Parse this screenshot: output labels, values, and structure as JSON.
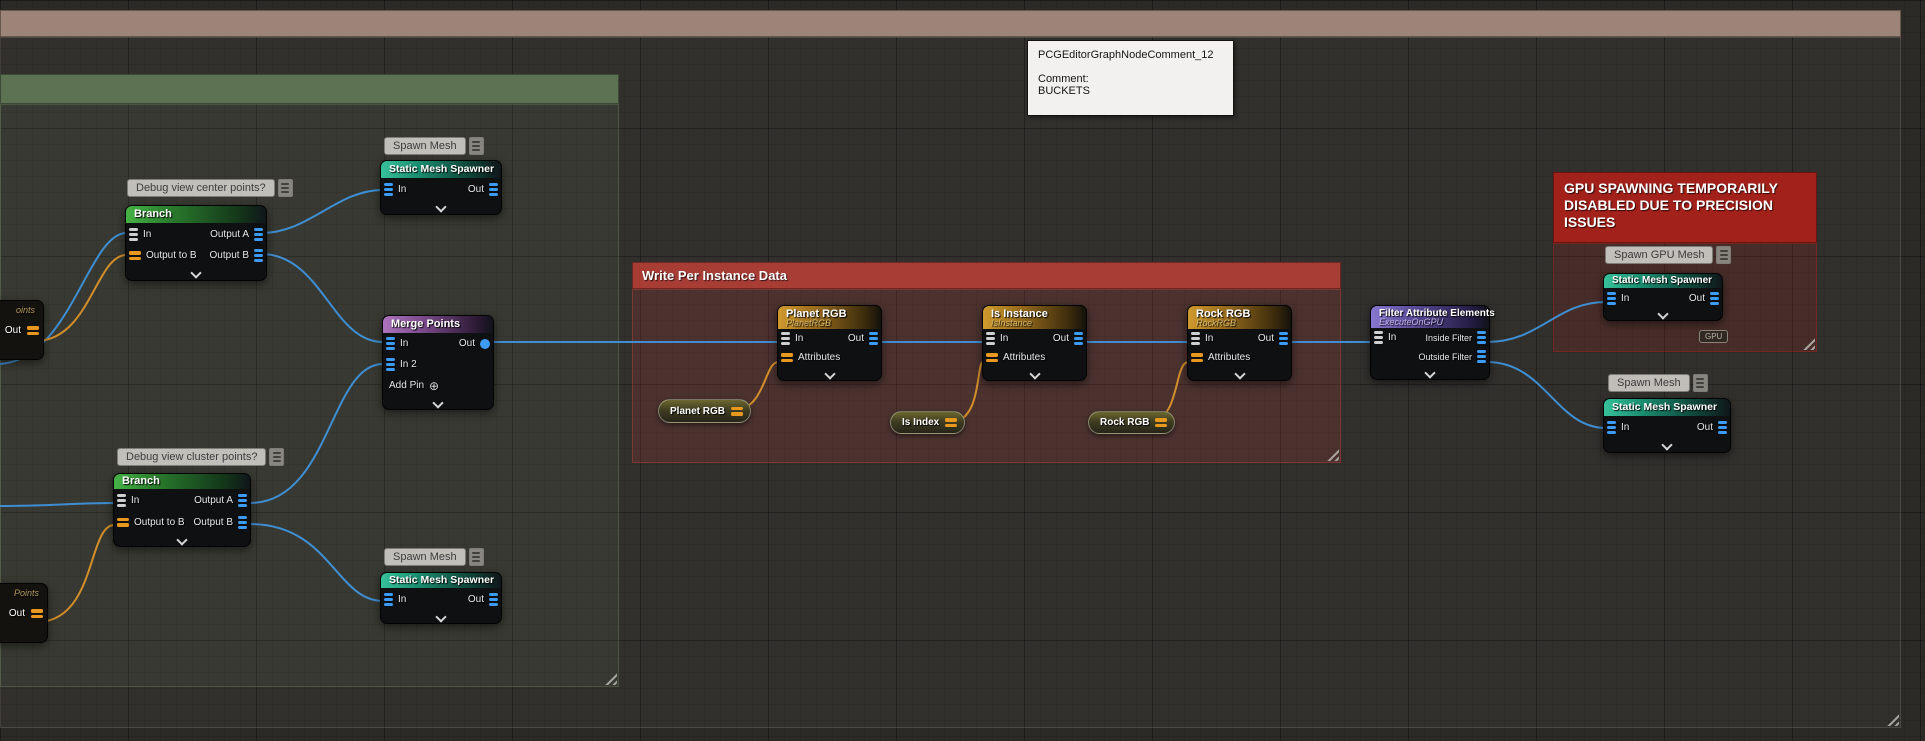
{
  "colors": {
    "wire-blue": "#3f8ed2",
    "wire-orange": "#d28e2a",
    "pin-blue": "#3c9bf5",
    "pin-orange": "#e8981e",
    "comment-tan": "#9d8478",
    "comment-green": "#5c7252",
    "comment-red": "#a83d36",
    "comment-red-bright": "#a2211a"
  },
  "tooltip": {
    "title": "PCGEditorGraphNodeComment_12",
    "comment_label": "Comment:",
    "comment_value": "BUCKETS"
  },
  "comments": {
    "write_per_instance": {
      "title": "Write Per Instance Data"
    },
    "gpu_warning": {
      "title": "GPU SPAWNING TEMPORARILY DISABLED DUE TO PRECISION ISSUES"
    }
  },
  "bubbles": {
    "debug_center": {
      "label": "Debug view center points?"
    },
    "debug_cluster": {
      "label": "Debug view cluster points?"
    },
    "spawn_mesh_top": {
      "label": "Spawn Mesh"
    },
    "spawn_mesh_bottom": {
      "label": "Spawn Mesh"
    },
    "spawn_mesh_right": {
      "label": "Spawn Mesh"
    },
    "spawn_gpu_mesh": {
      "label": "Spawn GPU Mesh"
    }
  },
  "nodes": {
    "branch_center": {
      "title": "Branch",
      "in": "In",
      "out_a": "Output A",
      "out_to_b": "Output to B",
      "out_b": "Output B"
    },
    "branch_cluster": {
      "title": "Branch",
      "in": "In",
      "out_a": "Output A",
      "out_to_b": "Output to B",
      "out_b": "Output B"
    },
    "sms_top": {
      "title": "Static Mesh Spawner",
      "in": "In",
      "out": "Out"
    },
    "sms_bottom": {
      "title": "Static Mesh Spawner",
      "in": "In",
      "out": "Out"
    },
    "sms_gpu": {
      "title": "Static Mesh Spawner",
      "in": "In",
      "out": "Out"
    },
    "sms_right": {
      "title": "Static Mesh Spawner",
      "in": "In",
      "out": "Out"
    },
    "merge_points": {
      "title": "Merge Points",
      "in": "In",
      "out": "Out",
      "in2": "In 2",
      "add_pin": "Add Pin"
    },
    "planet_rgb": {
      "title": "Planet RGB",
      "subtitle": "PlanetRGB",
      "in": "In",
      "out": "Out",
      "attributes": "Attributes"
    },
    "is_instance": {
      "title": "Is Instance",
      "subtitle": "IsInstance",
      "in": "In",
      "out": "Out",
      "attributes": "Attributes"
    },
    "rock_rgb": {
      "title": "Rock RGB",
      "subtitle": "RockRGB",
      "in": "In",
      "out": "Out",
      "attributes": "Attributes"
    },
    "filter_attr": {
      "title": "Filter Attribute Elements",
      "subtitle": "ExecuteOnGPU",
      "in": "In",
      "inside": "Inside Filter",
      "outside": "Outside Filter"
    },
    "left_points_a": {
      "subtitle": "oints",
      "out": "Out"
    },
    "left_points_b": {
      "subtitle": "Points",
      "out": "Out"
    }
  },
  "pills": {
    "planet_rgb": {
      "label": "Planet RGB"
    },
    "is_index": {
      "label": "Is Index"
    },
    "rock_rgb": {
      "label": "Rock RGB"
    }
  },
  "badges": {
    "gpu": "GPU"
  },
  "icons": {
    "add_pin": "⊕"
  }
}
